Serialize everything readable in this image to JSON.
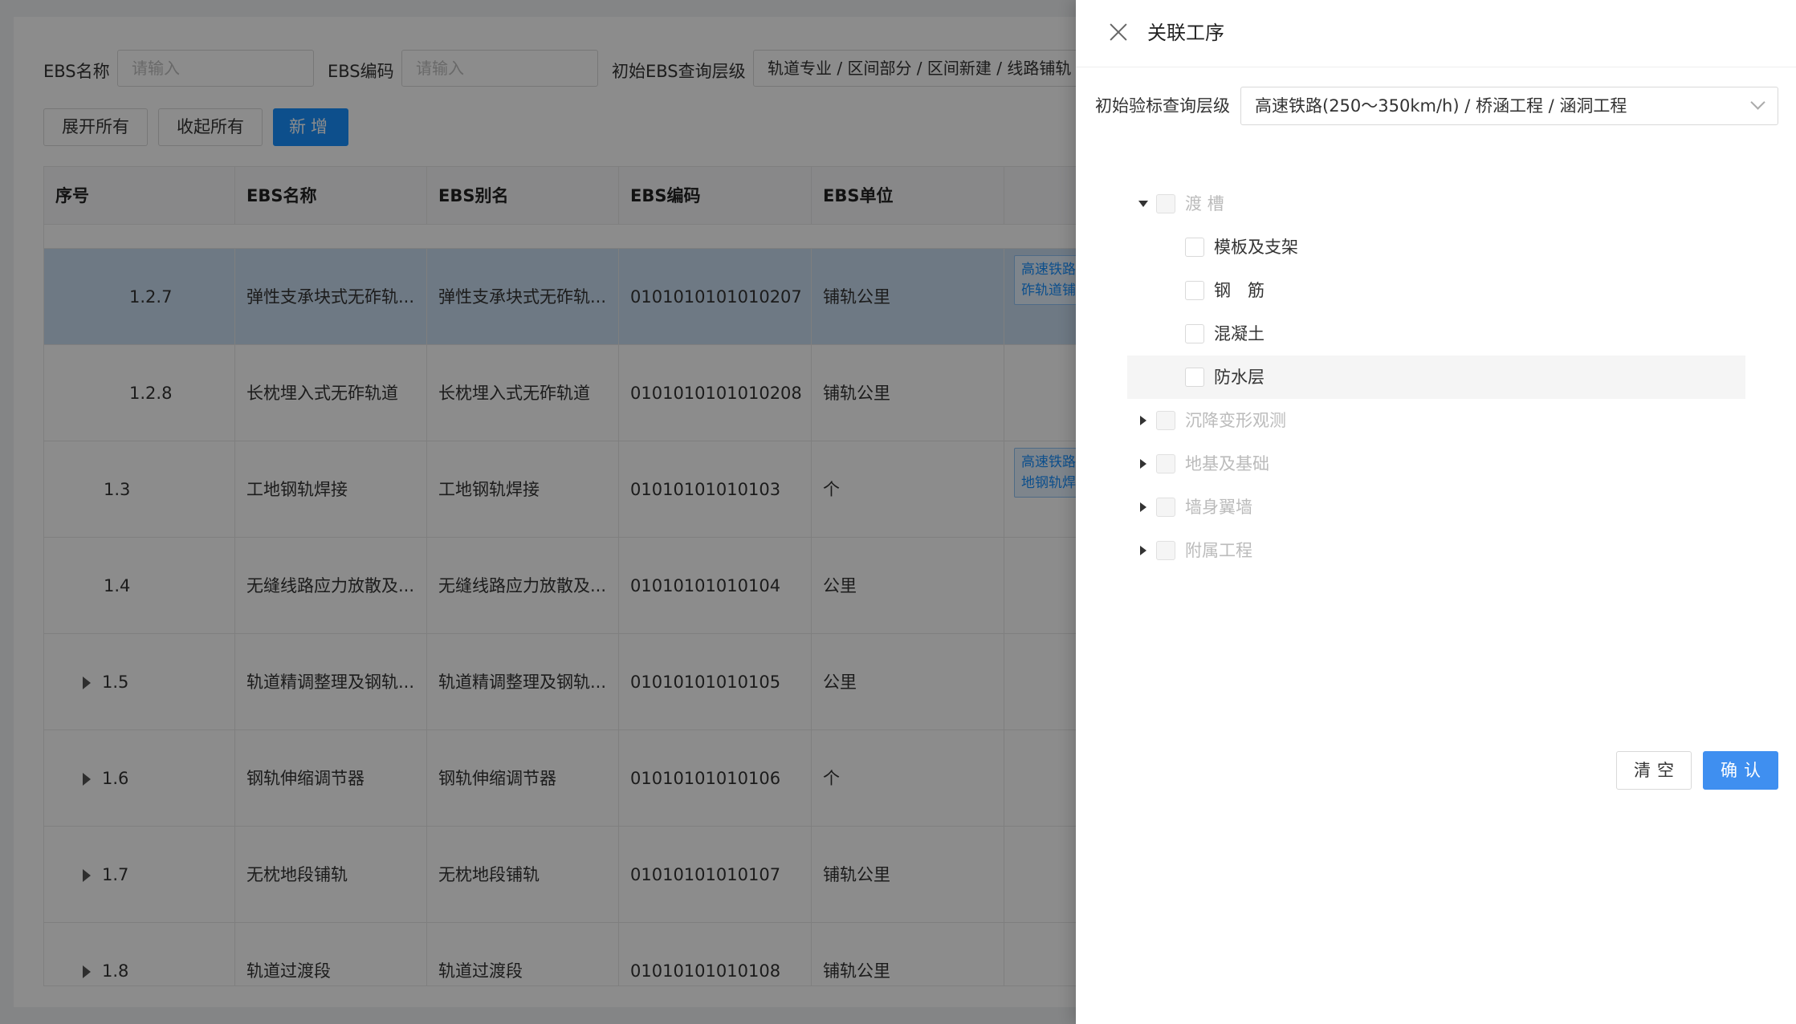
{
  "filters": {
    "ebs_name_label": "EBS名称",
    "ebs_name_placeholder": "请输入",
    "ebs_code_label": "EBS编码",
    "ebs_code_placeholder": "请输入",
    "level_label": "初始EBS查询层级",
    "level_value": "轨道专业 / 区间部分 / 区间新建 / 线路铺轨"
  },
  "toolbar": {
    "expand_all": "展开所有",
    "collapse_all": "收起所有",
    "add": "新增"
  },
  "table": {
    "columns": [
      "序号",
      "EBS名称",
      "EBS别名",
      "EBS编码",
      "EBS单位"
    ],
    "rows": [
      {
        "index": "1.2.7",
        "name": "弹性支承块式无砟轨...",
        "alias": "弹性支承块式无砟轨...",
        "code": "0101010101010207",
        "unit": "铺轨公里",
        "tag": "高速铁路\n砟轨道铺",
        "expandable": false,
        "selected": true
      },
      {
        "index": "1.2.8",
        "name": "长枕埋入式无砟轨道",
        "alias": "长枕埋入式无砟轨道",
        "code": "0101010101010208",
        "unit": "铺轨公里",
        "tag": "",
        "expandable": false,
        "selected": false
      },
      {
        "index": "1.3",
        "name": "工地钢轨焊接",
        "alias": "工地钢轨焊接",
        "code": "01010101010103",
        "unit": "个",
        "tag": "高速铁路\n地钢轨焊",
        "expandable": false,
        "selected": false
      },
      {
        "index": "1.4",
        "name": "无缝线路应力放散及...",
        "alias": "无缝线路应力放散及...",
        "code": "01010101010104",
        "unit": "公里",
        "tag": "",
        "expandable": false,
        "selected": false
      },
      {
        "index": "1.5",
        "name": "轨道精调整理及钢轨...",
        "alias": "轨道精调整理及钢轨...",
        "code": "01010101010105",
        "unit": "公里",
        "tag": "",
        "expandable": true,
        "selected": false
      },
      {
        "index": "1.6",
        "name": "钢轨伸缩调节器",
        "alias": "钢轨伸缩调节器",
        "code": "01010101010106",
        "unit": "个",
        "tag": "",
        "expandable": true,
        "selected": false
      },
      {
        "index": "1.7",
        "name": "无枕地段铺轨",
        "alias": "无枕地段铺轨",
        "code": "01010101010107",
        "unit": "铺轨公里",
        "tag": "",
        "expandable": true,
        "selected": false
      },
      {
        "index": "1.8",
        "name": "轨道过渡段",
        "alias": "轨道过渡段",
        "code": "01010101010108",
        "unit": "铺轨公里",
        "tag": "",
        "expandable": true,
        "selected": false
      }
    ]
  },
  "drawer": {
    "title": "关联工序",
    "level_label": "初始验标查询层级",
    "level_value": "高速铁路(250～350km/h) / 桥涵工程 / 涵洞工程",
    "tree": [
      {
        "label": "渡 槽",
        "expanded": true,
        "disabled": true,
        "children": [
          {
            "label": "模板及支架"
          },
          {
            "label": "钢　筋"
          },
          {
            "label": "混凝土"
          },
          {
            "label": "防水层",
            "hovered": true
          }
        ]
      },
      {
        "label": "沉降变形观测",
        "expanded": false,
        "disabled": true
      },
      {
        "label": "地基及基础",
        "expanded": false,
        "disabled": true
      },
      {
        "label": "墙身翼墙",
        "expanded": false,
        "disabled": true
      },
      {
        "label": "附属工程",
        "expanded": false,
        "disabled": true
      }
    ],
    "clear_label": "清空",
    "confirm_label": "确认"
  },
  "colors": {
    "primary": "#1890ff",
    "confirm": "#3f8ff0",
    "selected_row": "#c8dcf0"
  }
}
